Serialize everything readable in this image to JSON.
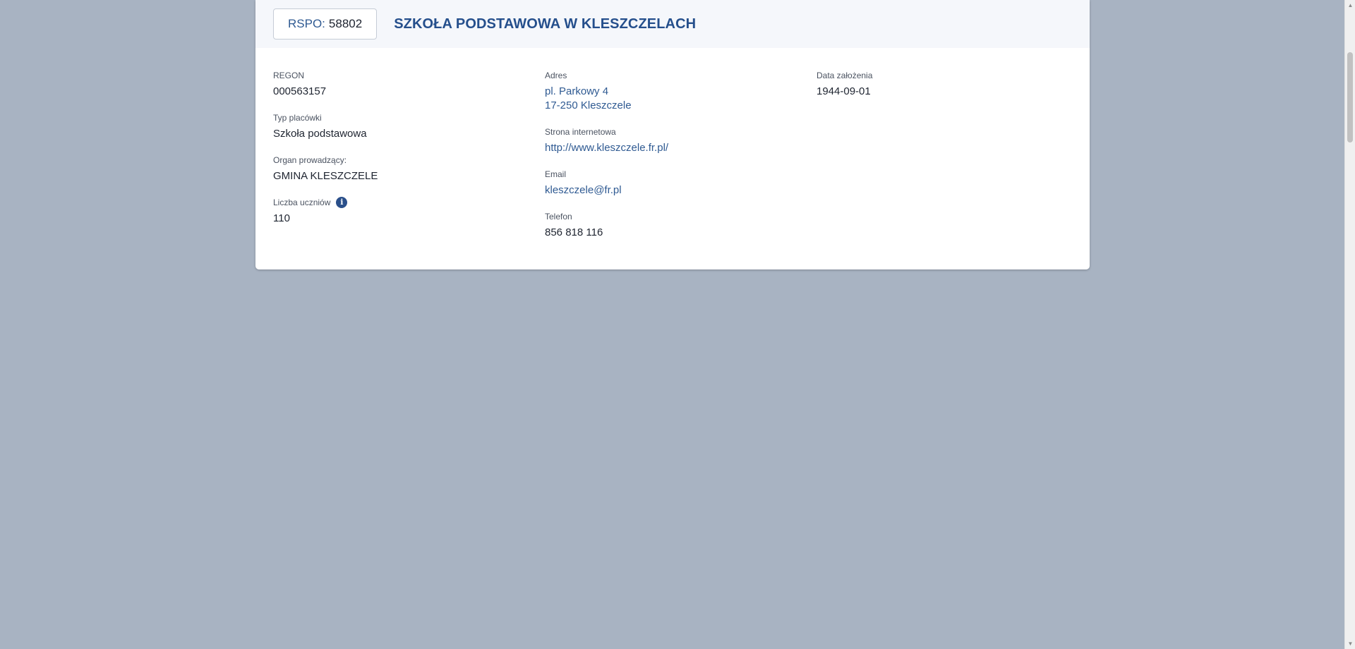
{
  "header": {
    "rspo_label": "RSPO:",
    "rspo_value": "58802",
    "title": "SZKOŁA PODSTAWOWA W KLESZCZELACH"
  },
  "fields": {
    "regon": {
      "label": "REGON",
      "value": "000563157"
    },
    "typ": {
      "label": "Typ placówki",
      "value": "Szkoła podstawowa"
    },
    "organ": {
      "label": "Organ prowadzący:",
      "value": "GMINA KLESZCZELE"
    },
    "uczniowie": {
      "label": "Liczba uczniów",
      "value": "110"
    },
    "adres": {
      "label": "Adres",
      "line1": "pl. Parkowy 4",
      "line2": "17-250 Kleszczele"
    },
    "strona": {
      "label": "Strona internetowa",
      "value": "http://www.kleszczele.fr.pl/"
    },
    "email": {
      "label": "Email",
      "value": "kleszczele@fr.pl"
    },
    "telefon": {
      "label": "Telefon",
      "value": "856 818 116"
    },
    "data": {
      "label": "Data założenia",
      "value": "1944-09-01"
    }
  },
  "icons": {
    "info": "info-icon",
    "scroll_up": "chevron-up-icon",
    "scroll_down": "chevron-down-icon"
  },
  "colors": {
    "page_background": "#a8b3c2",
    "accent": "#254f8c",
    "link": "#2f5a92"
  }
}
